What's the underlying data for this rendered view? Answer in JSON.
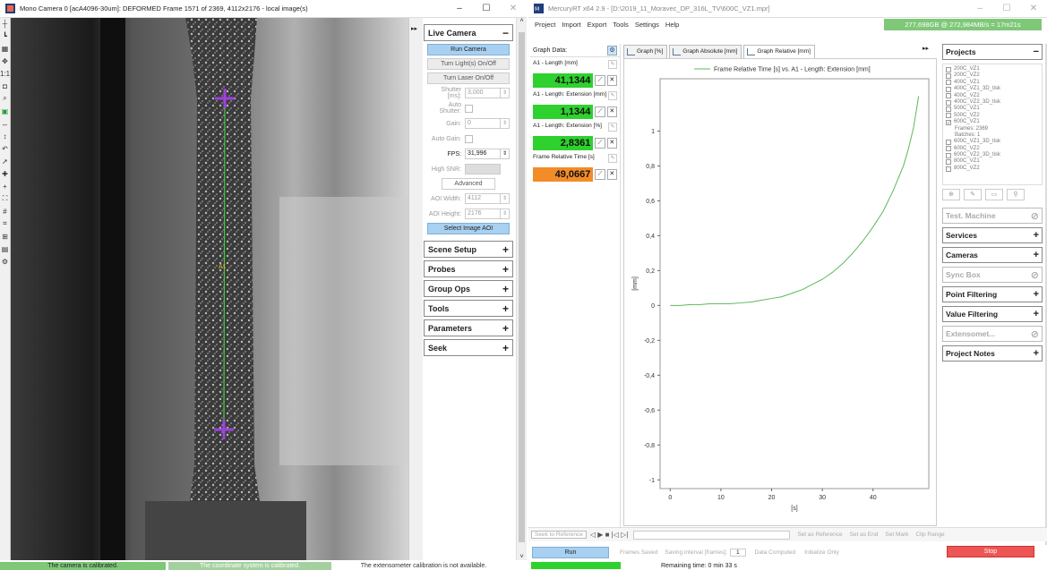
{
  "left_window": {
    "title": "Mono Camera 0 [acA4096-30um]: DEFORMED Frame 1571 of 2369, 4112x2176 - local image(s)",
    "minimize": "–",
    "maximize": "☐",
    "close": "✕",
    "overlay_label": "A1",
    "collapse_glyph": "▸▸",
    "scroll_up": "˄",
    "scroll_down": "˅",
    "tools": [
      "┼",
      "┗",
      "▦",
      "✥",
      "1:1",
      "◘",
      "⌕",
      "▣",
      "↔",
      "↕",
      "↶",
      "➚",
      "✚",
      "+",
      "⛶",
      "#",
      "⌗",
      "⊞",
      "▤",
      "⚙"
    ],
    "panel": {
      "live_camera": {
        "label": "Live Camera",
        "run_camera": "Run Camera",
        "lights": "Turn Light(s) On/Off",
        "laser": "Turn Laser On/Off",
        "shutter_label": "Shutter [ms]:",
        "shutter_value": "3,000",
        "auto_shutter_label": "Auto Shutter:",
        "gain_label": "Gain:",
        "gain_value": "0",
        "auto_gain_label": "Auto Gain:",
        "fps_label": "FPS:",
        "fps_value": "31,996",
        "high_snr_label": "High SNR:",
        "advanced": "Advanced",
        "aoi_width_label": "AOI Width:",
        "aoi_width_value": "4112",
        "aoi_height_label": "AOI Height:",
        "aoi_height_value": "2176",
        "select_aoi": "Select Image AOI"
      },
      "sections": [
        "Scene Setup",
        "Probes",
        "Group Ops",
        "Tools",
        "Parameters",
        "Seek"
      ]
    },
    "status": {
      "camera": "The camera is calibrated.",
      "coords": "The coordinate system is calibrated.",
      "extensometer": "The extensometer calibration is not available."
    }
  },
  "right_window": {
    "title": "MercuryRT x64 2.9 - [D:\\2019_11_Moravec_DP_316L_TV\\600C_VZ1.mpr]",
    "menu": [
      "Project",
      "Import",
      "Export",
      "Tools",
      "Settings",
      "Help"
    ],
    "memory": "277,698GB @ 272,984MB/s = 17m21s",
    "graph_data": {
      "header": "Graph Data:",
      "items": [
        {
          "label": "A1 - Length [mm]",
          "value": "41,1344",
          "color": "#2ed12e"
        },
        {
          "label": "A1 - Length: Extension [mm]",
          "value": "1,1344",
          "color": "#2ed12e"
        },
        {
          "label": "A1 - Length: Extension [%]",
          "value": "2,8361",
          "color": "#2ed12e"
        },
        {
          "label": "Frame Relative Time [s]",
          "value": "49,0667",
          "color": "#f28c28"
        }
      ]
    },
    "tabs": [
      "Graph [%]",
      "Graph Absolute [mm]",
      "Graph Relative [mm]"
    ],
    "toolbar": {
      "seek_ref": "Seek to Reference",
      "set_ref": "Set as Reference",
      "set_end": "Set as End",
      "set_mark": "Set Mark",
      "clip_range": "Clip Range"
    },
    "runbar": {
      "run": "Run",
      "frames_saved": "Frames Saved",
      "saving_interval": "Saving interval [frames]:",
      "interval_value": "1",
      "data_computed": "Data Computed",
      "initialize_only": "Initialize Only",
      "stop": "Stop"
    },
    "remaining": "Remaining time: 0 min 33 s",
    "projects_panel": {
      "projects": "Projects",
      "list": [
        "200C_VZ1",
        "200C_VZ2",
        "400C_VZ1",
        "400C_VZ1_3D_tisk",
        "400C_VZ2",
        "400C_VZ2_3D_tisk",
        "500C_VZ1",
        "500C_VZ2",
        "600C_VZ1"
      ],
      "frames": "Frames: 2369",
      "batches": "Batches: 1",
      "list2": [
        "600C_VZ1_3D_tisk",
        "600C_VZ2",
        "600C_VZ2_3D_tisk",
        "800C_VZ1",
        "800C_VZ2"
      ],
      "test_machine": "Test. Machine",
      "services": "Services",
      "cameras": "Cameras",
      "sync_box": "Sync Box",
      "point_filtering": "Point Filtering",
      "value_filtering": "Value Filtering",
      "extensometer": "Extensomet...",
      "project_notes": "Project Notes"
    }
  },
  "chart_data": {
    "type": "line",
    "title": "",
    "legend": "Frame Relative Time [s] vs. A1 - Length: Extension [mm]",
    "legend_position": "top",
    "xlabel": "[s]",
    "ylabel": "[mm]",
    "xlim": [
      -2,
      51
    ],
    "ylim": [
      -1.05,
      1.3
    ],
    "xticks": [
      0,
      10,
      20,
      30,
      40
    ],
    "yticks": [
      -1,
      -0.8,
      -0.6,
      -0.4,
      -0.2,
      0,
      0.2,
      0.4,
      0.6,
      0.8,
      1
    ],
    "ytick_labels": [
      "-1",
      "-0,8",
      "-0,6",
      "-0,4",
      "-0,2",
      "0",
      "0,2",
      "0,4",
      "0,6",
      "0,8",
      "1"
    ],
    "series": [
      {
        "name": "Frame Relative Time [s] vs. A1 - Length: Extension [mm]",
        "color": "#5cb85c",
        "x": [
          0,
          2,
          4,
          6,
          8,
          10,
          12,
          14,
          16,
          18,
          20,
          22,
          24,
          26,
          28,
          30,
          32,
          34,
          36,
          38,
          40,
          42,
          44,
          45,
          46,
          47,
          48,
          49
        ],
        "y": [
          0.0,
          0.0,
          0.005,
          0.005,
          0.01,
          0.01,
          0.01,
          0.015,
          0.02,
          0.03,
          0.04,
          0.05,
          0.07,
          0.09,
          0.12,
          0.15,
          0.19,
          0.24,
          0.3,
          0.37,
          0.45,
          0.54,
          0.66,
          0.73,
          0.8,
          0.9,
          1.02,
          1.2
        ]
      }
    ]
  }
}
